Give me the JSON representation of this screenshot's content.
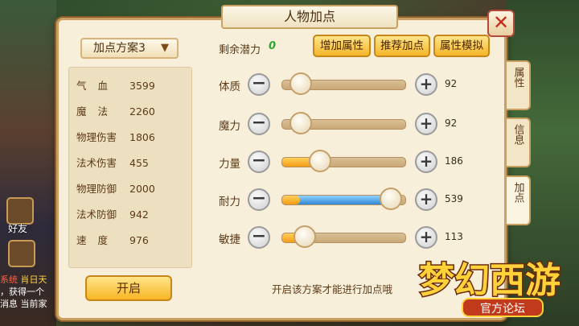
{
  "window": {
    "title": "人物加点",
    "close_glyph": "✕"
  },
  "background": {
    "friend_label": "好友",
    "chat_lines": [
      {
        "tag": "系统",
        "rest": " 肖日天"
      },
      {
        "tag": "",
        "rest": "，获得一个"
      },
      {
        "tag": "",
        "rest": "消息 当前家"
      }
    ]
  },
  "plan": {
    "selected": "加点方案3",
    "open_button": "开启"
  },
  "stats": [
    {
      "label": "气血",
      "spread": true,
      "value": "3599"
    },
    {
      "label": "魔法",
      "spread": true,
      "value": "2260"
    },
    {
      "label": "物理伤害",
      "spread": false,
      "value": "1806"
    },
    {
      "label": "法术伤害",
      "spread": false,
      "value": "455"
    },
    {
      "label": "物理防御",
      "spread": false,
      "value": "2000"
    },
    {
      "label": "法术防御",
      "spread": false,
      "value": "942"
    },
    {
      "label": "速度",
      "spread": true,
      "value": "976"
    }
  ],
  "potential": {
    "label": "剩余潜力",
    "value": "0"
  },
  "buttons": {
    "add_attr": "增加属性",
    "recommend": "推荐加点",
    "simulate": "属性模拟"
  },
  "attributes": [
    {
      "label": "体质",
      "value": "92",
      "fill": 0.15,
      "fill_color": "none"
    },
    {
      "label": "魔力",
      "value": "92",
      "fill": 0.15,
      "fill_color": "none"
    },
    {
      "label": "力量",
      "value": "186",
      "fill": 0.31,
      "fill_color": "orange"
    },
    {
      "label": "耐力",
      "value": "539",
      "fill": 0.88,
      "fill_color": "blue"
    },
    {
      "label": "敏捷",
      "value": "113",
      "fill": 0.18,
      "fill_color": "orange"
    }
  ],
  "hint": "开启该方案才能进行加点哦",
  "side_tabs": [
    "属性",
    "信息",
    "加点"
  ],
  "logo": {
    "main": "梦幻西游",
    "sub": "官方论坛"
  },
  "colors": {
    "accent_gold": "#f5b52a",
    "blue_fill": "#2f86d6",
    "close_red": "#c62a1a"
  }
}
